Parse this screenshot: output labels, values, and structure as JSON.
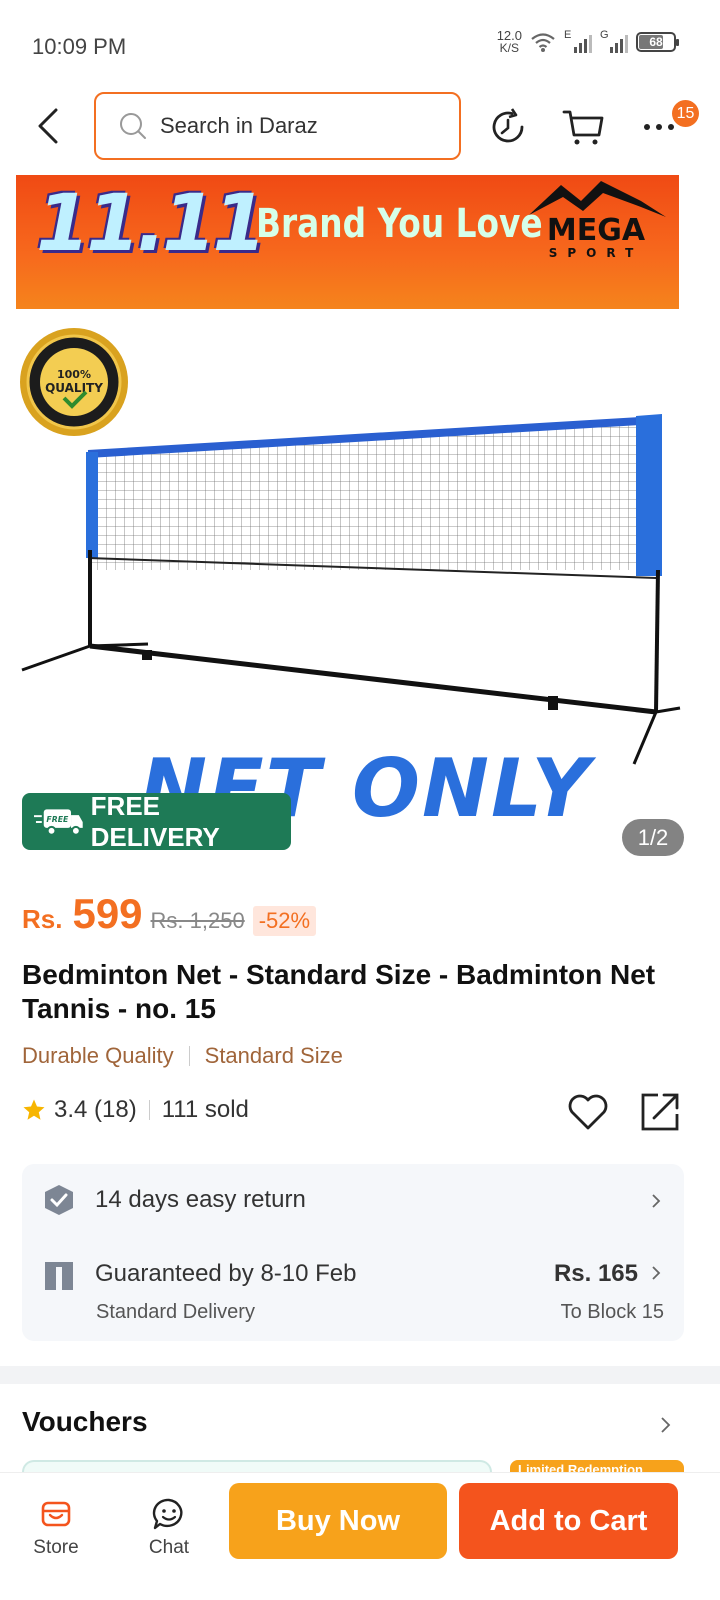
{
  "status_bar": {
    "time": "10:09 PM",
    "net_speed_value": "12.0",
    "net_speed_unit": "K/S",
    "sim1_label": "E",
    "sim2_label": "G",
    "battery": "68"
  },
  "header": {
    "search_placeholder": "Search in Daraz",
    "cart_badge": "15"
  },
  "banner": {
    "big_text": "11.11",
    "tagline": "Brand You Love",
    "brand_line1": "MEGA",
    "brand_line2": "SPORT"
  },
  "gallery": {
    "seal_text": "100% QUALITY",
    "image_caption": "NET ONLY",
    "free_badge_small": "FREE",
    "free_delivery": "FREE DELIVERY",
    "page_indicator": "1/2"
  },
  "price": {
    "currency": "Rs.",
    "value": "599",
    "original": "Rs. 1,250",
    "discount": "-52%"
  },
  "product": {
    "title": "Bedminton Net - Standard Size - Badminton Net Tannis - no. 15",
    "tags": [
      "Durable Quality",
      "Standard Size"
    ],
    "rating": "3.4 (18)",
    "sold": "111 sold"
  },
  "services": {
    "return_text": "14 days easy return",
    "delivery_text": "Guaranteed by 8-10 Feb",
    "delivery_sub": "Standard Delivery",
    "delivery_price": "Rs. 165",
    "delivery_location": "To Block 15"
  },
  "vouchers": {
    "title": "Vouchers",
    "peek_label": "Limited Redemption"
  },
  "bottom_bar": {
    "store": "Store",
    "chat": "Chat",
    "buy_now": "Buy Now",
    "add_to_cart": "Add to Cart"
  },
  "colors": {
    "accent": "#f36f21",
    "buy_now": "#f7a21b",
    "add_cart": "#f4541d",
    "free_delivery": "#1e7a56"
  }
}
